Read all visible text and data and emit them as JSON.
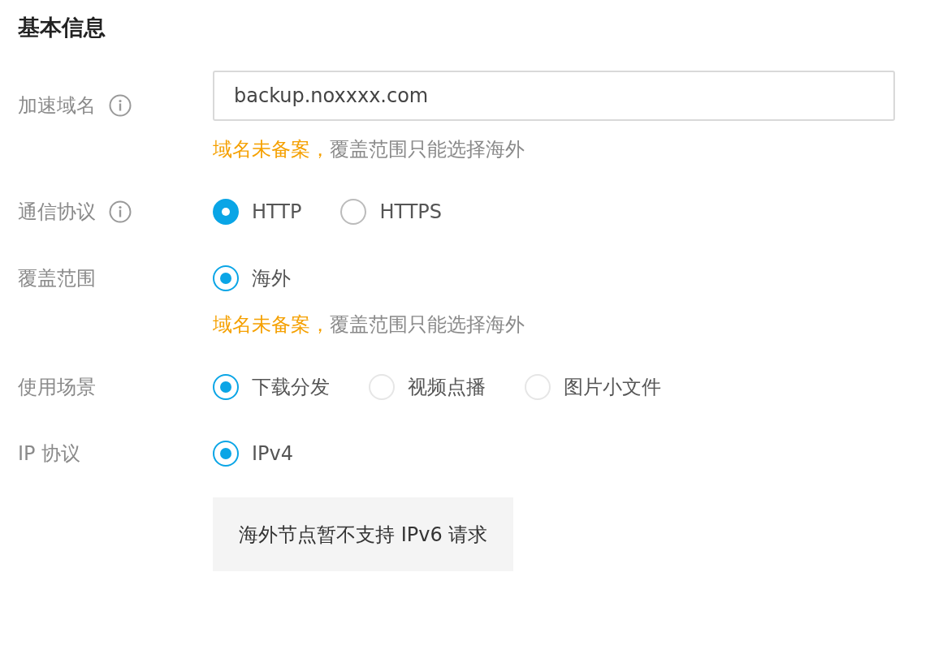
{
  "section_title": "基本信息",
  "fields": [
    {
      "kind": "input",
      "label": "加速域名",
      "info": true,
      "value": "backup.noxxxx.com",
      "hint": {
        "alert": "域名未备案，",
        "detail": "覆盖范围只能选择海外"
      }
    },
    {
      "kind": "radio",
      "label": "通信协议",
      "info": true,
      "options": [
        {
          "label": "HTTP",
          "selected": true,
          "focused": true,
          "disabled": false
        },
        {
          "label": "HTTPS",
          "selected": false,
          "focused": false,
          "disabled": false
        }
      ]
    },
    {
      "kind": "radio",
      "label": "覆盖范围",
      "info": false,
      "options": [
        {
          "label": "海外",
          "selected": true,
          "focused": false,
          "disabled": false
        }
      ],
      "hint": {
        "alert": "域名未备案，",
        "detail": "覆盖范围只能选择海外"
      }
    },
    {
      "kind": "radio",
      "label": "使用场景",
      "info": false,
      "options": [
        {
          "label": "下载分发",
          "selected": true,
          "focused": false,
          "disabled": false
        },
        {
          "label": "视频点播",
          "selected": false,
          "focused": false,
          "disabled": true
        },
        {
          "label": "图片小文件",
          "selected": false,
          "focused": false,
          "disabled": true
        }
      ]
    },
    {
      "kind": "radio",
      "label": "IP 协议",
      "info": false,
      "options": [
        {
          "label": "IPv4",
          "selected": true,
          "focused": false,
          "disabled": false
        }
      ],
      "note": "海外节点暂不支持 IPv6 请求"
    }
  ]
}
